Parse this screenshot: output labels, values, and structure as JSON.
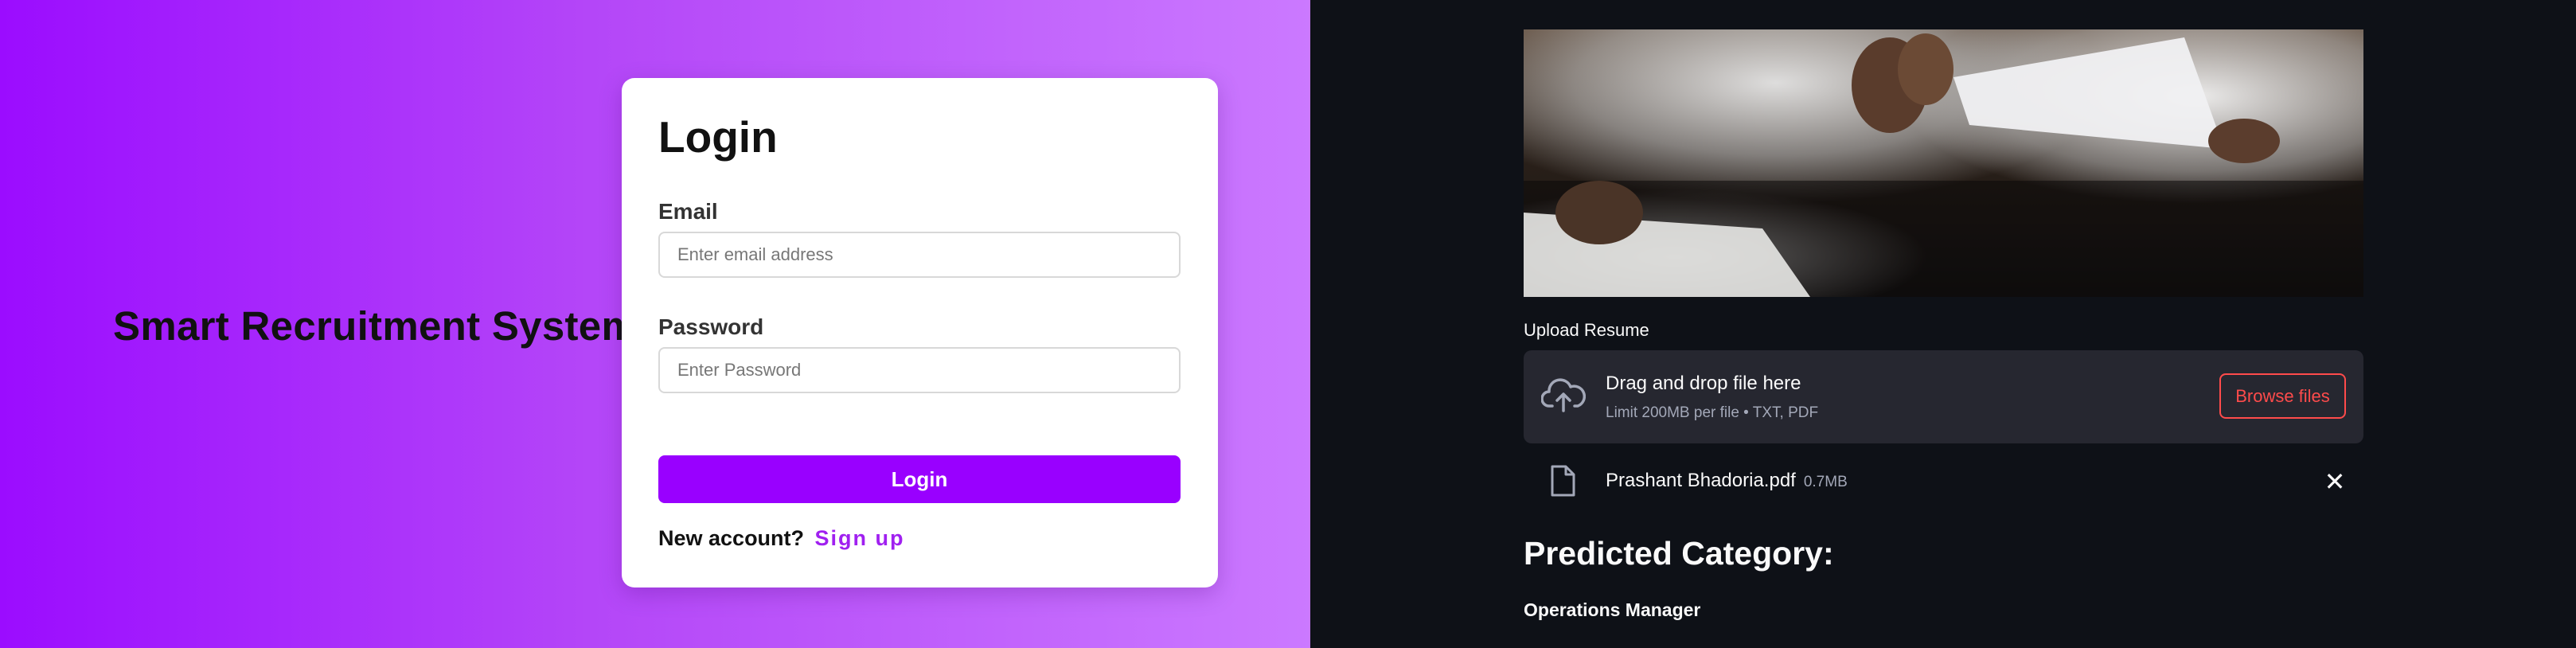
{
  "left_panel": {
    "brand_title": "Smart Recruitment System",
    "login_card": {
      "heading": "Login",
      "email_label": "Email",
      "email_placeholder": "Enter email address",
      "email_value": "",
      "password_label": "Password",
      "password_placeholder": "Enter Password",
      "password_value": "",
      "login_button": "Login",
      "new_account_text": "New account?",
      "signup_link": "Sign up"
    },
    "colors": {
      "accent": "#9900ff",
      "link": "#a020f0"
    }
  },
  "right_panel": {
    "header_image": "handshake-photo",
    "upload": {
      "label": "Upload Resume",
      "dropzone_title": "Drag and drop file here",
      "dropzone_limit": "Limit 200MB per file • TXT, PDF",
      "browse_button": "Browse files",
      "icon": "cloud-upload-icon"
    },
    "uploaded_file": {
      "name": "Prashant Bhadoria.pdf",
      "size": "0.7MB",
      "icon": "file-icon",
      "remove_icon": "close-icon"
    },
    "prediction": {
      "heading": "Predicted Category:",
      "value": "Operations Manager"
    },
    "colors": {
      "background": "#0e1117",
      "surface": "#262730",
      "danger": "#ff4b4b"
    }
  }
}
